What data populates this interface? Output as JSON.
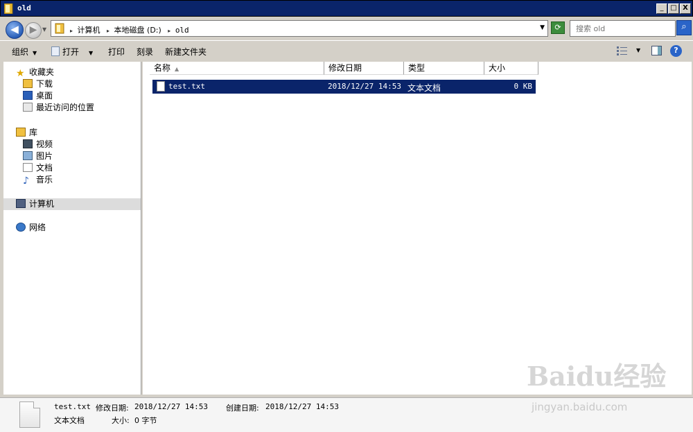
{
  "window": {
    "title": "old",
    "buttons": {
      "minimize": "_",
      "maximize": "□",
      "close": "X"
    }
  },
  "address": {
    "crumbs": [
      "计算机",
      "本地磁盘 (D:)",
      "old"
    ],
    "search_placeholder": "搜索 old"
  },
  "toolbar": {
    "organize": "组织",
    "open": "打开",
    "print": "打印",
    "burn": "刻录",
    "new_folder": "新建文件夹"
  },
  "nav": {
    "favorites": "收藏夹",
    "fav_items": [
      "下载",
      "桌面",
      "最近访问的位置"
    ],
    "libraries": "库",
    "lib_items": [
      "视频",
      "图片",
      "文档",
      "音乐"
    ],
    "computer": "计算机",
    "network": "网络"
  },
  "columns": {
    "name": "名称",
    "date": "修改日期",
    "type": "类型",
    "size": "大小"
  },
  "files": [
    {
      "name": "test.txt",
      "date": "2018/12/27 14:53",
      "type": "文本文档",
      "size": "0 KB"
    }
  ],
  "details": {
    "name": "test.txt",
    "modified_label": "修改日期:",
    "modified": "2018/12/27 14:53",
    "created_label": "创建日期:",
    "created": "2018/12/27 14:53",
    "type": "文本文档",
    "size_label": "大小:",
    "size": "0 字节"
  },
  "watermark": {
    "main": "Baidu经验",
    "sub": "jingyan.baidu.com"
  },
  "colors": {
    "titlebar": "#0a246a",
    "selection": "#0a246a",
    "chrome": "#d4d0c8"
  }
}
